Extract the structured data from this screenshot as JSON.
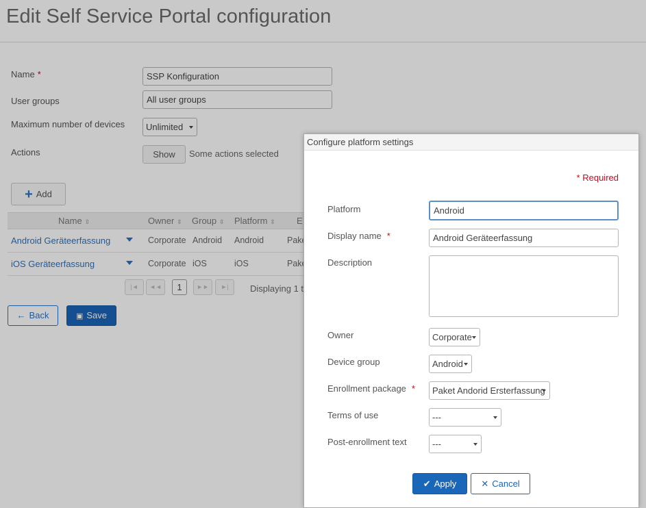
{
  "page": {
    "title": "Edit Self Service Portal configuration"
  },
  "form": {
    "name_label": "Name",
    "name_required": "*",
    "name_value": "SSP Konfiguration",
    "user_groups_label": "User groups",
    "user_groups_value": "All user groups",
    "max_devices_label": "Maximum number of devices",
    "max_devices_value": "Unlimited",
    "actions_label": "Actions",
    "actions_button": "Show",
    "actions_status": "Some actions selected",
    "add_button": "Add"
  },
  "table": {
    "columns": [
      "Name",
      "Owner",
      "Group",
      "Platform",
      "E"
    ],
    "sort_glyph": "⇳",
    "rows": [
      {
        "name": "Android Geräteerfassung",
        "owner": "Corporate",
        "group": "Android",
        "platform": "Android",
        "package": "Pake"
      },
      {
        "name": "iOS Geräteerfassung",
        "owner": "Corporate",
        "group": "iOS",
        "platform": "iOS",
        "package": "Pake"
      }
    ],
    "pager": {
      "first": "|◄",
      "prev": "◄◄",
      "page": "1",
      "next": "►►",
      "last": "►|",
      "display_text": "Displaying 1 t"
    }
  },
  "footer": {
    "back_button": "Back",
    "save_button": "Save"
  },
  "dialog": {
    "title": "Configure platform settings",
    "required_note": "* Required",
    "platform_label": "Platform",
    "platform_value": "Android",
    "display_name_label": "Display name",
    "display_name_required": "*",
    "display_name_value": "Android Geräteerfassung",
    "description_label": "Description",
    "description_value": "",
    "owner_label": "Owner",
    "owner_value": "Corporate",
    "device_group_label": "Device group",
    "device_group_value": "Android",
    "enrollment_label": "Enrollment package",
    "enrollment_required": "*",
    "enrollment_value": "Paket Andorid Ersterfassung",
    "terms_label": "Terms of use",
    "terms_value": "---",
    "post_label": "Post-enrollment text",
    "post_value": "---",
    "apply_button": "Apply",
    "cancel_button": "Cancel"
  },
  "colors": {
    "accent": "#1a66b8",
    "link": "#2a73c5",
    "required": "#d0021b"
  }
}
